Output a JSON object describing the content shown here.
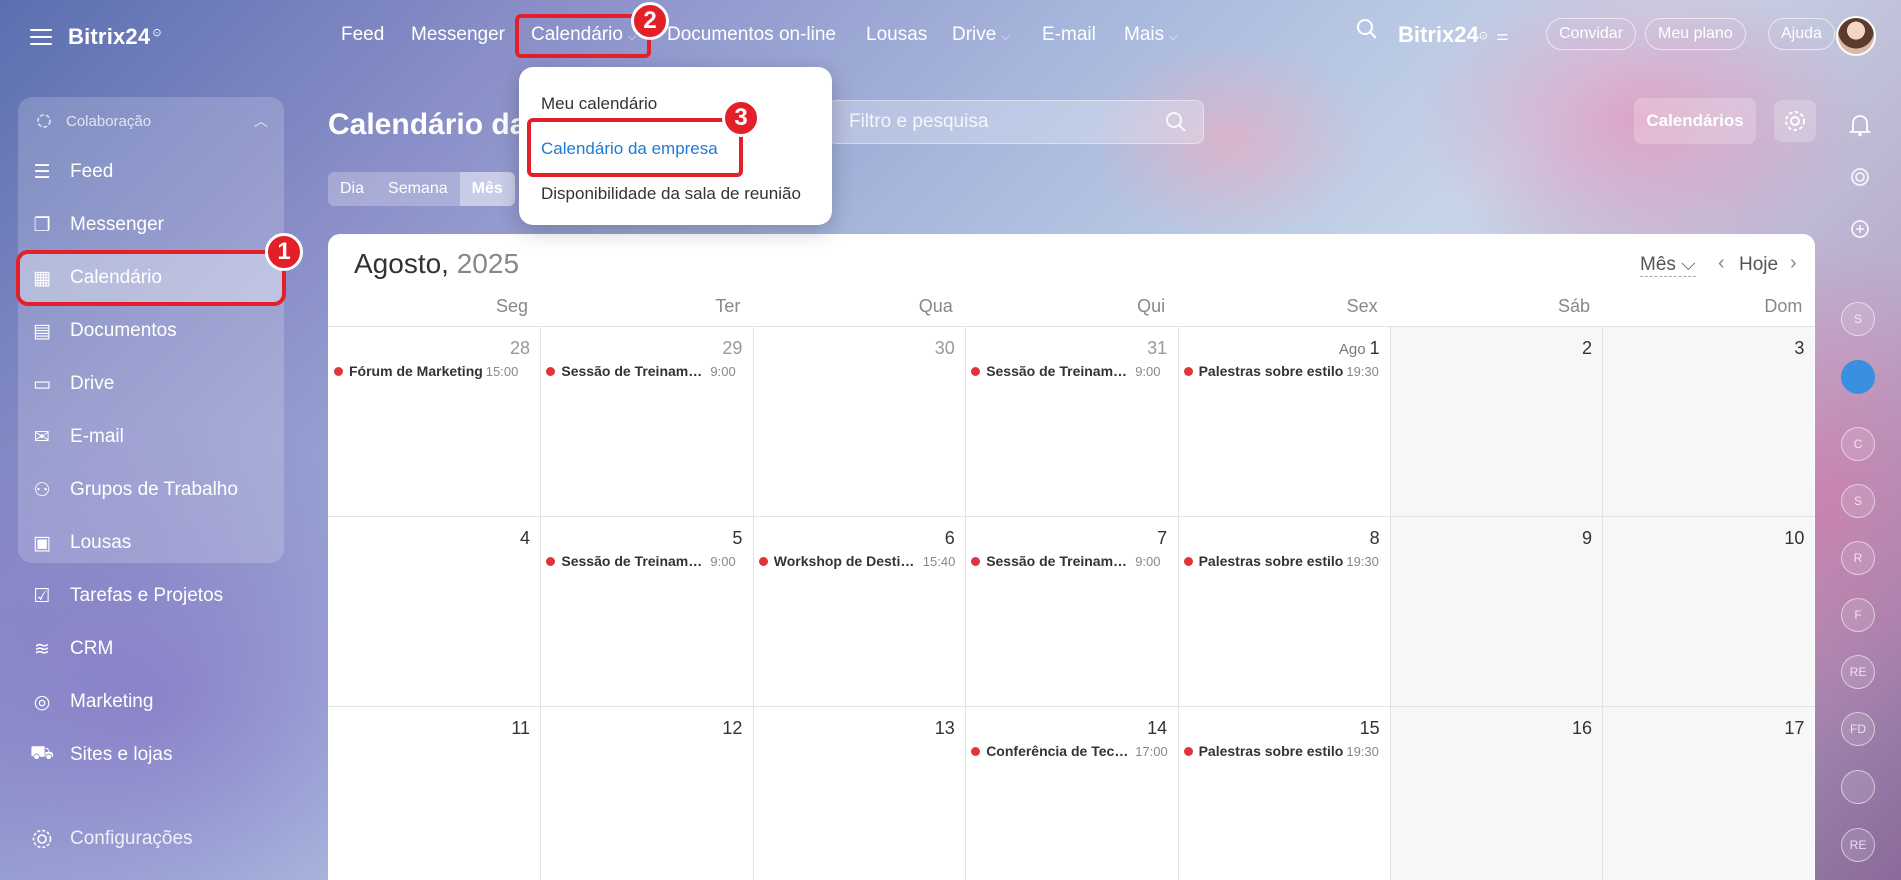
{
  "app": {
    "brand": "Bitrix24",
    "brand_mark": "⊙"
  },
  "sidebar": {
    "group_label": "Colaboração",
    "items": [
      {
        "label": "Feed",
        "icon": "feed-icon"
      },
      {
        "label": "Messenger",
        "icon": "messenger-icon"
      },
      {
        "label": "Calendário",
        "icon": "calendar-icon",
        "active": true
      },
      {
        "label": "Documentos",
        "icon": "documents-icon"
      },
      {
        "label": "Drive",
        "icon": "drive-icon"
      },
      {
        "label": "E-mail",
        "icon": "email-icon"
      },
      {
        "label": "Grupos de Trabalho",
        "icon": "workgroups-icon"
      },
      {
        "label": "Lousas",
        "icon": "boards-icon"
      },
      {
        "label": "Tarefas e Projetos",
        "icon": "tasks-icon"
      },
      {
        "label": "CRM",
        "icon": "crm-icon"
      },
      {
        "label": "Marketing",
        "icon": "marketing-icon"
      },
      {
        "label": "Sites e lojas",
        "icon": "cart-icon"
      }
    ],
    "settings": "Configurações"
  },
  "topnav": {
    "items": [
      "Feed",
      "Messenger",
      "Calendário",
      "Documentos on-line",
      "Lousas",
      "Drive",
      "E-mail",
      "Mais"
    ],
    "brand": "Bitrix24",
    "invite": "Convidar",
    "plan": "Meu plano",
    "help": "Ajuda"
  },
  "dropdown": {
    "items": [
      "Meu calendário",
      "Calendário da empresa",
      "Disponibilidade da sala de reunião"
    ]
  },
  "page": {
    "title": "Calendário da",
    "search_placeholder": "Filtro e pesquisa",
    "calendars_button": "Calendários",
    "views": [
      "Dia",
      "Semana",
      "Mês"
    ]
  },
  "calendar": {
    "month": "Agosto,",
    "year": "2025",
    "view_select": "Mês",
    "today": "Hoje",
    "weekdays": [
      "Seg",
      "Ter",
      "Qua",
      "Qui",
      "Sex",
      "Sáb",
      "Dom"
    ],
    "month_prefix": "Ago",
    "weeks": [
      [
        "28",
        "29",
        "30",
        "31",
        "1",
        "2",
        "3"
      ],
      [
        "4",
        "5",
        "6",
        "7",
        "8",
        "9",
        "10"
      ],
      [
        "11",
        "12",
        "13",
        "14",
        "15",
        "16",
        "17"
      ]
    ],
    "events": [
      {
        "week": 0,
        "day": 0,
        "title": "Fórum de Marketing",
        "time": "15:00"
      },
      {
        "week": 0,
        "day": 1,
        "title": "Sessão de Treinamento",
        "time": "9:00"
      },
      {
        "week": 0,
        "day": 3,
        "title": "Sessão de Treinamento",
        "time": "9:00"
      },
      {
        "week": 0,
        "day": 4,
        "title": "Palestras sobre estilo",
        "time": "19:30"
      },
      {
        "week": 1,
        "day": 1,
        "title": "Sessão de Treinamento",
        "time": "9:00"
      },
      {
        "week": 1,
        "day": 2,
        "title": "Workshop de Destinos",
        "time": "15:40"
      },
      {
        "week": 1,
        "day": 3,
        "title": "Sessão de Treinamento",
        "time": "9:00"
      },
      {
        "week": 1,
        "day": 4,
        "title": "Palestras sobre estilo",
        "time": "19:30"
      },
      {
        "week": 2,
        "day": 3,
        "title": "Conferência de Tecnologia",
        "time": "17:00"
      },
      {
        "week": 2,
        "day": 4,
        "title": "Palestras sobre estilo",
        "time": "19:30"
      }
    ]
  },
  "annotations": [
    "1",
    "2",
    "3"
  ],
  "rail": {
    "avatars": [
      "S",
      "",
      "C",
      "S",
      "R",
      "F",
      "RE",
      "FD",
      "",
      "RE"
    ]
  },
  "colors": {
    "accent": "#e3202a",
    "event_dot": "#e0343a",
    "link": "#1e7ad6"
  }
}
